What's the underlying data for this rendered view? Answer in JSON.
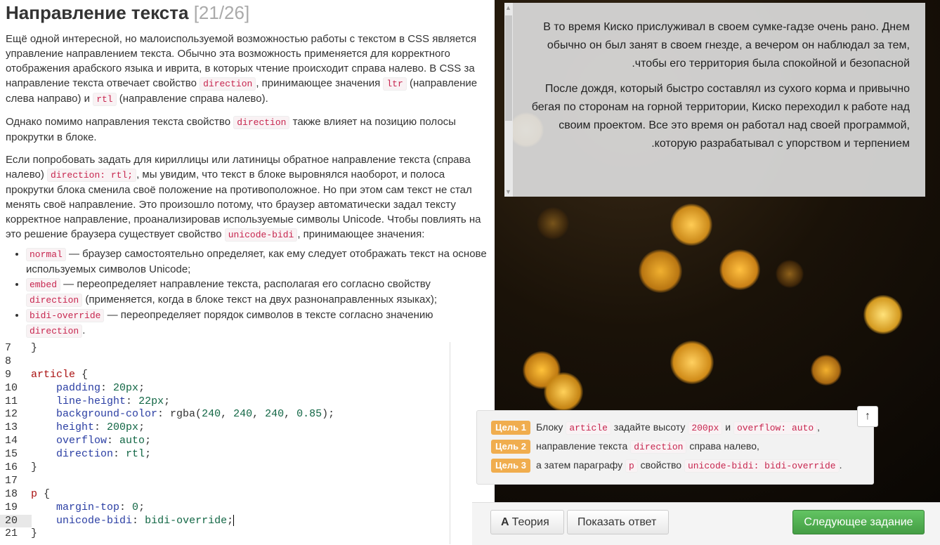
{
  "lesson": {
    "title": "Направление текста",
    "counter": "[21/26]",
    "p1_a": "Ещё одной интересной, но малоиспользуемой возможностью работы с текстом в CSS является управление направлением текста. Обычно эта возможность применяется для корректного отображения арабского языка и иврита, в которых чтение происходит справа налево. В CSS за направление текста отвечает свойство ",
    "p1_code1": "direction",
    "p1_b": ", принимающее значения ",
    "p1_code2": "ltr",
    "p1_c": " (направление слева направо) и ",
    "p1_code3": "rtl",
    "p1_d": " (направление справа налево).",
    "p2_a": "Однако помимо направления текста свойство ",
    "p2_code": "direction",
    "p2_b": " также влияет на позицию полосы прокрутки в блоке.",
    "p3_a": "Если попробовать задать для кириллицы или латиницы обратное направление текста (справа налево) ",
    "p3_code1": "direction: rtl;",
    "p3_b": ", мы увидим, что текст в блоке выровнялся наоборот, и полоса прокрутки блока сменила своё положение на противоположное. Но при этом сам текст не стал менять своё направление. Это произошло потому, что браузер автоматически задал тексту корректное направление, проанализировав используемые символы Unicode. Чтобы повлиять на это решение браузера существует свойство ",
    "p3_code2": "unicode-bidi",
    "p3_c": ", принимающее значения:",
    "list": [
      {
        "code": "normal",
        "text": " — браузер самостоятельно определяет, как ему следует отображать текст на основе используемых символов Unicode;"
      },
      {
        "code": "embed",
        "text_a": " — переопределяет направление текста, располагая его согласно свойству ",
        "code2": "direction",
        "text_b": " (применяется, когда в блоке текст на двух разнонаправленных языках);"
      },
      {
        "code": "bidi-override",
        "text_a": " — переопределяет порядок символов в тексте согласно значению ",
        "code2": "direction",
        "text_b": "."
      }
    ]
  },
  "editor": {
    "lines": [
      {
        "n": "7",
        "text": "}"
      },
      {
        "n": "8",
        "text": ""
      },
      {
        "n": "9",
        "text": "article {"
      },
      {
        "n": "10",
        "text": "    padding: 20px;"
      },
      {
        "n": "11",
        "text": "    line-height: 22px;"
      },
      {
        "n": "12",
        "text": "    background-color: rgba(240, 240, 240, 0.85);"
      },
      {
        "n": "13",
        "text": "    height: 200px;"
      },
      {
        "n": "14",
        "text": "    overflow: auto;"
      },
      {
        "n": "15",
        "text": "    direction: rtl;"
      },
      {
        "n": "16",
        "text": "}"
      },
      {
        "n": "17",
        "text": ""
      },
      {
        "n": "18",
        "text": "p {"
      },
      {
        "n": "19",
        "text": "    margin-top: 0;"
      },
      {
        "n": "20",
        "text": "    unicode-bidi: bidi-override;"
      },
      {
        "n": "21",
        "text": "}"
      }
    ],
    "active_line": "20"
  },
  "preview": {
    "paragraph1": "В то время Киско прислуживал в своем сумке-гадзе очень рано. Днем обычно он был занят в своем гнезде, а вечером он наблюдал за тем, чтобы его территория была спокойной и безопасной.",
    "paragraph2": "После дождя, который быстро составлял из сухого корма и привычно бегая по сторонам на горной территории, Киско переходил к работе над своим проектом. Все это время он работал над своей программой, которую разрабатывал с упорством и терпением."
  },
  "goals": [
    {
      "badge": "Цель 1",
      "t1": "Блоку ",
      "c1": "article",
      "t2": " задайте высоту ",
      "c2": "200px",
      "t3": " и ",
      "c3": "overflow: auto",
      "t4": ","
    },
    {
      "badge": "Цель 2",
      "t1": "направление текста ",
      "c1": "direction",
      "t2": " справа налево,"
    },
    {
      "badge": "Цель 3",
      "t1": "а затем параграфу ",
      "c1": "p",
      "t2": " свойство ",
      "c2": "unicode-bidi: bidi-override",
      "t3": "."
    }
  ],
  "buttons": {
    "theory_icon": "A",
    "theory": "Теория",
    "answer": "Показать ответ",
    "next": "Следующее задание",
    "up_icon": "↑"
  },
  "colors": {
    "accent_green": "#449d44",
    "goal_badge": "#f0ad4e",
    "code_red": "#c7254e"
  }
}
